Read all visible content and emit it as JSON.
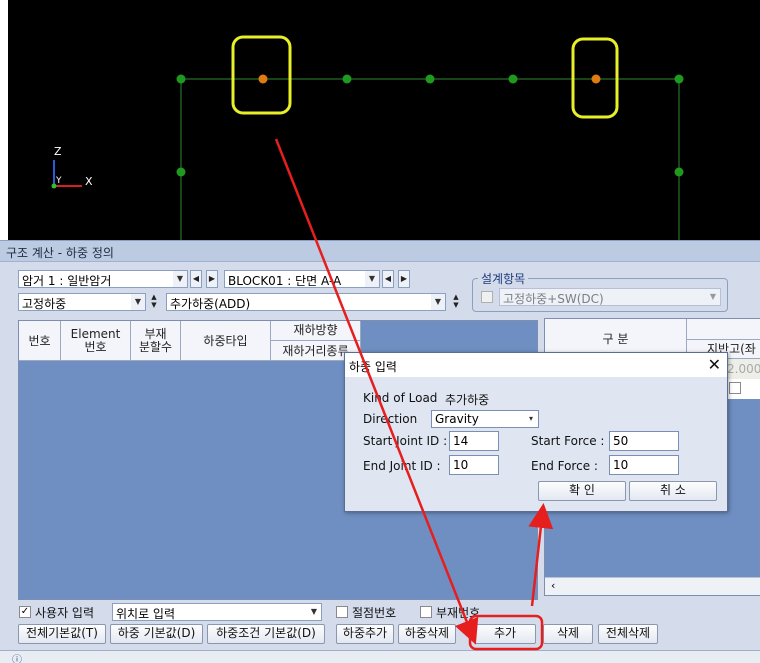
{
  "viewport": {
    "axis_z": "Z",
    "axis_y": "Y",
    "axis_x": "X"
  },
  "panel": {
    "title": "구조 계산 - 하중 정의"
  },
  "toolbar": {
    "combo_load_case": "암거 1 : 일반암거",
    "combo_block": "BLOCK01 : 단면 A-A",
    "combo_load_type": "고정하중",
    "combo_load_kind": "추가하중(ADD)"
  },
  "design": {
    "label": "설계항목",
    "combo_value": "고정하중+SW(DC)"
  },
  "grid": {
    "headers": {
      "number": "번호",
      "element": "Element\n번호",
      "division": "부재\n분할수",
      "load_type": "하중타입",
      "load_direction": "재하방향",
      "load_distance": "재하거리종류"
    }
  },
  "grid2": {
    "header_division": "구 분",
    "header_support": "지반고(좌",
    "value": "2.000"
  },
  "dialog": {
    "title": "하중 입력",
    "kind_label": "Kind of Load",
    "kind_value": "추가하중",
    "direction_label": "Direction",
    "direction_value": "Gravity",
    "start_joint_label": "Start Joint ID :",
    "start_joint_value": "14",
    "end_joint_label": "End  Joint ID :",
    "end_joint_value": "10",
    "start_force_label": "Start Force :",
    "start_force_value": "50",
    "end_force_label": "End  Force :",
    "end_force_value": "10",
    "ok_label": "확  인",
    "cancel_label": "취  소"
  },
  "options": {
    "user_input_label": "사용자 입력",
    "position_input": "위치로 입력",
    "joint_number_label": "절점번호",
    "member_number_label": "부재번호"
  },
  "buttons": {
    "all_default": "전체기본값(T)",
    "load_default": "하중 기본값(D)",
    "load_condition_default": "하중조건 기본값(D)",
    "load_add": "하중추가",
    "load_delete": "하중삭제",
    "add": "추가",
    "delete": "삭제",
    "delete_all": "전체삭제"
  },
  "colors": {
    "highlight": "#e8ef27",
    "arrow": "#e61e1e",
    "node": "#1e9a1e",
    "node_selected": "#e07b12"
  }
}
